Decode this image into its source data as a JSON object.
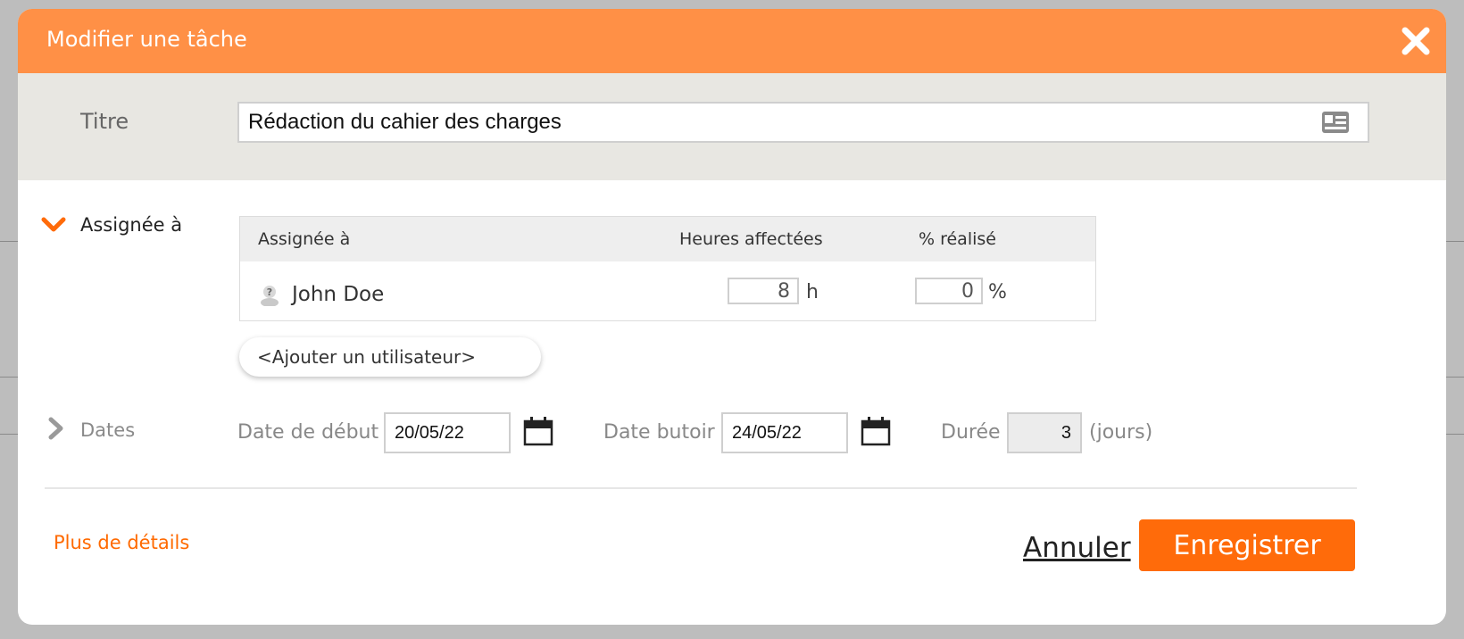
{
  "dialog": {
    "title": "Modifier une tâche"
  },
  "title_field": {
    "label": "Titre",
    "value": "Rédaction du cahier des charges"
  },
  "assigned_section": {
    "label": "Assignée à",
    "table": {
      "headers": [
        "Assignée à",
        "Heures affectées",
        "% réalisé"
      ],
      "rows": [
        {
          "name": "John Doe",
          "hours": "8",
          "hours_unit": "h",
          "percent": "0",
          "percent_unit": "%"
        }
      ]
    },
    "add_user_label": "<Ajouter un utilisateur>"
  },
  "dates_section": {
    "label": "Dates",
    "start_label": "Date de début",
    "start_value": "20/05/22",
    "due_label": "Date butoir",
    "due_value": "24/05/22",
    "duration_label": "Durée",
    "duration_value": "3",
    "duration_unit": "(jours)"
  },
  "footer": {
    "details_link": "Plus de détails",
    "cancel_label": "Annuler",
    "save_label": "Enregistrer"
  },
  "colors": {
    "header": "#ff9046",
    "accent": "#ff6b0a"
  },
  "icons": {
    "close": "close-icon",
    "title_card": "id-card-icon",
    "assigned_toggle": "chevron-down-icon",
    "dates_toggle": "chevron-right-icon",
    "user": "unknown-user-icon",
    "calendar": "calendar-icon"
  }
}
